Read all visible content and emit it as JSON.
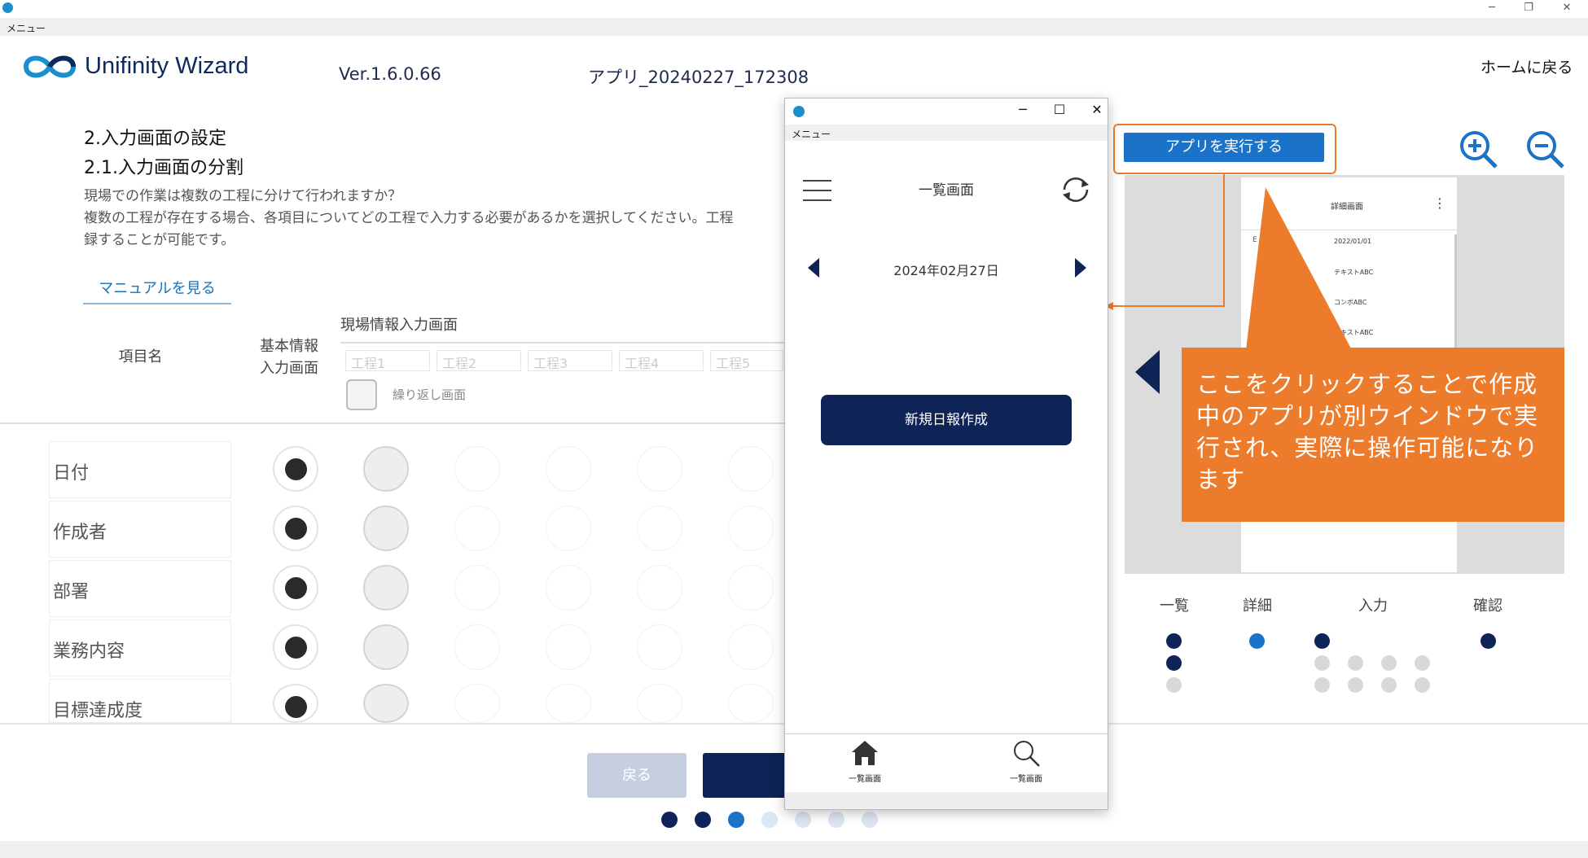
{
  "window": {
    "title": "",
    "menu": "メニュー",
    "min": "─",
    "max": "❐",
    "close": "✕"
  },
  "header": {
    "logo_text": "Unifinity Wizard",
    "version": "Ver.1.6.0.66",
    "app_name": "アプリ_20240227_172308",
    "home": "ホームに戻る"
  },
  "section": {
    "title": "2.入力画面の設定",
    "subtitle": "2.1.入力画面の分割",
    "desc1": "現場での作業は複数の工程に分けて行われますか？",
    "desc2": "複数の工程が存在する場合、各項目についてどの工程で入力する必要があるかを選択してください。工程",
    "desc3": "録することが可能です。",
    "manual_link": "マニュアルを見る"
  },
  "table": {
    "col_item": "項目名",
    "col_basic": "基本情報\n入力画面",
    "col_site": "現場情報入力画面",
    "steps": [
      "工程1",
      "工程2",
      "工程3",
      "工程4",
      "工程5"
    ],
    "repeat_label": "繰り返し画面",
    "rows": [
      "日付",
      "作成者",
      "部署",
      "業務内容",
      "目標達成度"
    ]
  },
  "footer": {
    "back": "戻る",
    "progress_total": 7,
    "progress_done": 2,
    "progress_current": 3
  },
  "popup": {
    "menu": "メニュー",
    "min": "─",
    "max": "☐",
    "close": "✕",
    "screen_title": "一覧画面",
    "date": "2024年02月27日",
    "new_button": "新規日報作成",
    "nav": [
      "一覧画面",
      "一覧画面"
    ]
  },
  "run_button": "アプリを実行する",
  "preview": {
    "title": "詳細画面",
    "rows": [
      "2022/01/01",
      "テキストABC",
      "コンボABC",
      "テキストABC"
    ],
    "row_prefix": "E"
  },
  "callout": "ここをクリックすることで作成中のアプリが別ウインドウで実行され、実際に操作可能になります",
  "legend": {
    "list": "一覧",
    "detail": "詳細",
    "input": "入力",
    "confirm": "確認"
  },
  "colors": {
    "navy": "#0e2356",
    "blue": "#1a73c8",
    "orange": "#ec7b2c"
  }
}
